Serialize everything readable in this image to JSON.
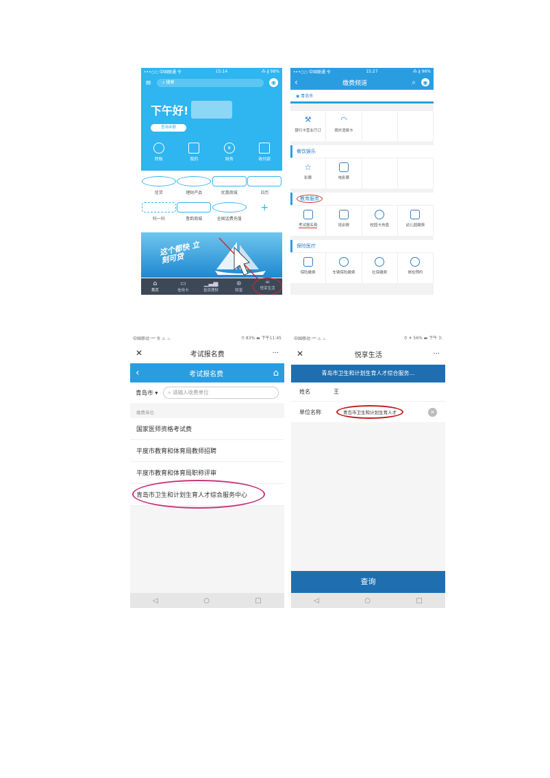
{
  "shot1": {
    "status": {
      "carrier": "•••○○ 中国联通 令",
      "time": "15:14",
      "battery": "⁂ ∦ 98%"
    },
    "search_placeholder": "搜索",
    "greeting": "下午好!",
    "account_button": "查询余额",
    "top_items": [
      "转账",
      "我的",
      "财务",
      "收付款"
    ],
    "grid_row1": [
      "信贷",
      "理财产品",
      "优惠商城",
      "日历"
    ],
    "grid_row2": [
      "扫一扫",
      "鲁韵商城",
      "全国话费充值",
      "+"
    ],
    "banner_text": "这个都快 立刻可贷",
    "tabs": [
      "首页",
      "信用卡",
      "投资理财",
      "财富",
      "悦享生活"
    ],
    "colors": {
      "primary": "#2fb5ef",
      "highlight": "#d12a6b"
    }
  },
  "shot2": {
    "status": {
      "carrier": "•••○○ 中国联通 令",
      "time": "15:27",
      "battery": "⁂ ∦ 96%"
    },
    "title": "缴费频道",
    "city": "青岛市",
    "row0": [
      "银行卡营业厅订",
      "境外消费卡"
    ],
    "sections": [
      {
        "name": "餐饮娱乐",
        "items": [
          "彩票",
          "电影票"
        ]
      },
      {
        "name": "教育服务",
        "items": [
          "考试报名费",
          "培训费",
          "校园卡充值",
          "幼儿园缴费"
        ]
      },
      {
        "name": "保险医疗",
        "items": [
          "保险缴费",
          "车辆保险缴费",
          "社保缴费",
          "体检预约"
        ]
      }
    ]
  },
  "shot3": {
    "status": {
      "left": "中国移动 ᶜᵃˡˡ 令 ⚠ ♨",
      "right": "⏱ 83% ▬ 下午11:45"
    },
    "window_title": "考试报名费",
    "more": "···",
    "page_title": "考试报名费",
    "city": "青岛市 ▾",
    "search_placeholder": "请输入收费单位",
    "section_label": "缴费单位",
    "items": [
      "国家医师资格考试费",
      "平度市教育和体育局教师招聘",
      "平度市教育和体育局职称评审",
      "青岛市卫生和计划生育人才综合服务中心"
    ]
  },
  "shot4": {
    "status": {
      "left": "中国移动 ᶜᵃˡˡ ⚠ ♨",
      "right": "⏱ ✈ 56% ▬ 下午 3:"
    },
    "window_title": "悦享生活",
    "more": "···",
    "org": "青岛市卫生和计划生育人才综合服务…",
    "name_label": "姓名",
    "name_value": "王",
    "unit_label": "单位名称",
    "unit_value": "青岛市卫生和计划生育人才",
    "query_button": "查询",
    "nav": [
      "◁",
      "○",
      "□"
    ]
  }
}
